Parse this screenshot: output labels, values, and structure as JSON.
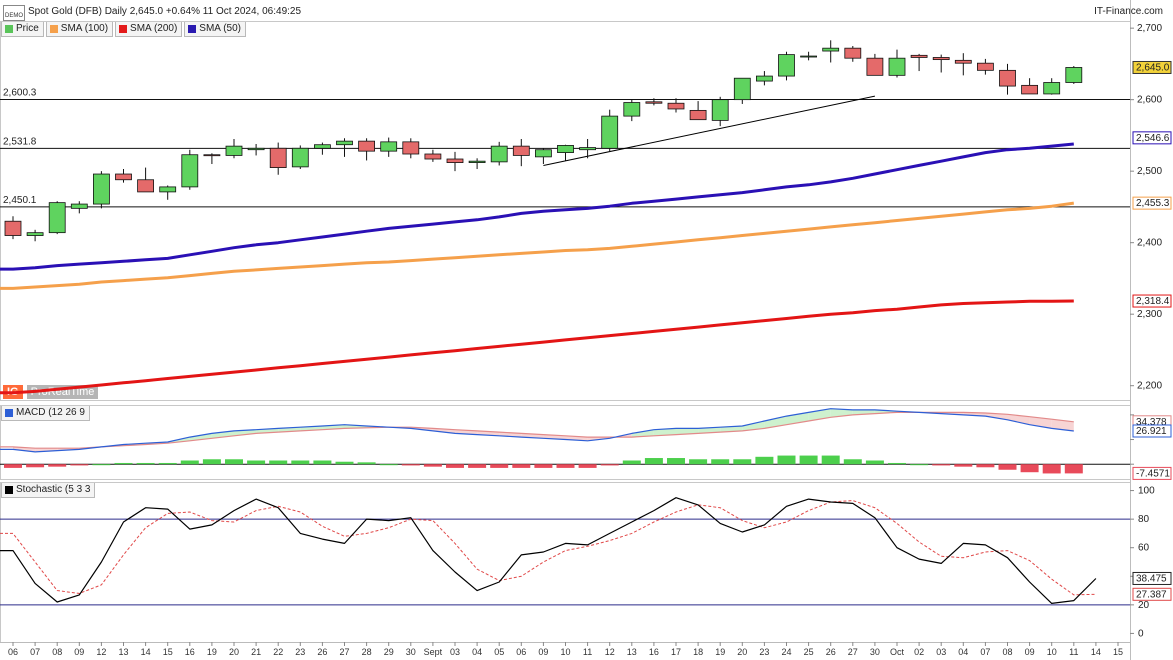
{
  "header": {
    "title": "Spot Gold (DFB) Daily 2,645.0 +0.64% 11 Oct 2024, 06:49:25",
    "brand": "IT-Finance.com",
    "badge": "DEMO",
    "logo_text": "IG",
    "logo_name": "ProRealTime"
  },
  "legend": [
    {
      "label": "Price",
      "color": "#59c459"
    },
    {
      "label": "SMA (100)",
      "color": "#f5a04b"
    },
    {
      "label": "SMA (200)",
      "color": "#e31a1a"
    },
    {
      "label": "SMA (50)",
      "color": "#2a1ab0"
    }
  ],
  "colors": {
    "up": "#5fd35f",
    "down": "#e46a6a",
    "sma50": "#2a10b5",
    "sma100": "#f5a04b",
    "sma200": "#e31515",
    "macd": "#2d5fd6",
    "signal": "#e28a8a",
    "stoch_k": "#000000",
    "stoch_d": "#e04848"
  },
  "chart_data": [
    {
      "type": "candlestick",
      "panel": "price",
      "categories": [
        "06",
        "07",
        "08",
        "09",
        "12",
        "13",
        "14",
        "15",
        "16",
        "19",
        "20",
        "21",
        "22",
        "23",
        "26",
        "27",
        "28",
        "29",
        "30",
        "Sept",
        "03",
        "04",
        "05",
        "06",
        "09",
        "10",
        "11",
        "12",
        "13",
        "16",
        "17",
        "18",
        "19",
        "20",
        "23",
        "24",
        "25",
        "26",
        "27",
        "30",
        "Oct",
        "02",
        "03",
        "04",
        "07",
        "08",
        "09",
        "10",
        "11"
      ],
      "x_ticks": [
        "06",
        "07",
        "08",
        "09",
        "12",
        "13",
        "14",
        "15",
        "16",
        "19",
        "20",
        "21",
        "22",
        "23",
        "26",
        "27",
        "28",
        "29",
        "30",
        "Sept",
        "03",
        "04",
        "05",
        "06",
        "09",
        "10",
        "11",
        "12",
        "13",
        "16",
        "17",
        "18",
        "19",
        "20",
        "23",
        "24",
        "25",
        "26",
        "27",
        "30",
        "Oct",
        "02",
        "03",
        "04",
        "07",
        "08",
        "09",
        "10",
        "11",
        "14",
        "15"
      ],
      "ohlc": [
        [
          2430,
          2437,
          2405,
          2410
        ],
        [
          2410,
          2418,
          2402,
          2414
        ],
        [
          2414,
          2458,
          2412,
          2456
        ],
        [
          2448,
          2458,
          2441,
          2454
        ],
        [
          2454,
          2500,
          2448,
          2496
        ],
        [
          2496,
          2503,
          2484,
          2488
        ],
        [
          2488,
          2505,
          2473,
          2471
        ],
        [
          2471,
          2480,
          2460,
          2478
        ],
        [
          2478,
          2530,
          2474,
          2523
        ],
        [
          2523,
          2525,
          2510,
          2522
        ],
        [
          2522,
          2545,
          2518,
          2535
        ],
        [
          2530,
          2538,
          2522,
          2532
        ],
        [
          2532,
          2540,
          2495,
          2505
        ],
        [
          2506,
          2536,
          2503,
          2532
        ],
        [
          2532,
          2540,
          2523,
          2537
        ],
        [
          2537,
          2546,
          2520,
          2542
        ],
        [
          2542,
          2546,
          2515,
          2528
        ],
        [
          2528,
          2547,
          2520,
          2541
        ],
        [
          2541,
          2546,
          2518,
          2524
        ],
        [
          2524,
          2530,
          2513,
          2517
        ],
        [
          2517,
          2527,
          2500,
          2512
        ],
        [
          2512,
          2518,
          2503,
          2514
        ],
        [
          2513,
          2541,
          2508,
          2535
        ],
        [
          2535,
          2545,
          2507,
          2522
        ],
        [
          2520,
          2532,
          2510,
          2530
        ],
        [
          2526,
          2537,
          2515,
          2536
        ],
        [
          2530,
          2545,
          2518,
          2533
        ],
        [
          2532,
          2586,
          2528,
          2577
        ],
        [
          2577,
          2600,
          2570,
          2596
        ],
        [
          2597,
          2602,
          2592,
          2595
        ],
        [
          2595,
          2602,
          2582,
          2587
        ],
        [
          2585,
          2598,
          2572,
          2572
        ],
        [
          2571,
          2604,
          2563,
          2600
        ],
        [
          2600,
          2628,
          2594,
          2630
        ],
        [
          2626,
          2640,
          2620,
          2633
        ],
        [
          2633,
          2667,
          2627,
          2663
        ],
        [
          2661,
          2667,
          2655,
          2661
        ],
        [
          2668,
          2683,
          2652,
          2672
        ],
        [
          2672,
          2675,
          2653,
          2658
        ],
        [
          2658,
          2664,
          2639,
          2634
        ],
        [
          2634,
          2670,
          2631,
          2658
        ],
        [
          2662,
          2664,
          2640,
          2659
        ],
        [
          2659,
          2663,
          2638,
          2656
        ],
        [
          2655,
          2665,
          2634,
          2651
        ],
        [
          2651,
          2657,
          2635,
          2641
        ],
        [
          2641,
          2650,
          2607,
          2619
        ],
        [
          2620,
          2630,
          2609,
          2608
        ],
        [
          2608,
          2630,
          2607,
          2624
        ],
        [
          2624,
          2647,
          2622,
          2645
        ]
      ],
      "sma50": [
        2363,
        2365,
        2368,
        2370,
        2372,
        2374,
        2376,
        2378,
        2383,
        2388,
        2393,
        2397,
        2400,
        2404,
        2408,
        2412,
        2416,
        2420,
        2423,
        2426,
        2429,
        2432,
        2436,
        2441,
        2444,
        2446,
        2448,
        2451,
        2455,
        2458,
        2461,
        2464,
        2467,
        2470,
        2474,
        2478,
        2481,
        2485,
        2490,
        2496,
        2502,
        2508,
        2514,
        2520,
        2526,
        2530,
        2532,
        2535,
        2538
      ],
      "sma100": [
        2336,
        2338,
        2340,
        2342,
        2345,
        2347,
        2349,
        2351,
        2354,
        2357,
        2360,
        2362,
        2364,
        2366,
        2368,
        2370,
        2372,
        2373,
        2375,
        2377,
        2379,
        2381,
        2383,
        2385,
        2387,
        2389,
        2390,
        2392,
        2395,
        2398,
        2401,
        2404,
        2407,
        2410,
        2413,
        2416,
        2419,
        2422,
        2425,
        2428,
        2431,
        2434,
        2437,
        2440,
        2443,
        2446,
        2448,
        2451,
        2455.3
      ],
      "sma200": [
        2190,
        2192,
        2195,
        2198,
        2201,
        2204,
        2207,
        2210,
        2213,
        2216,
        2219,
        2222,
        2225,
        2228,
        2231,
        2234,
        2237,
        2240,
        2243,
        2246,
        2249,
        2252,
        2255,
        2258,
        2261,
        2264,
        2267,
        2270,
        2273,
        2276,
        2279,
        2282,
        2285,
        2288,
        2291,
        2294,
        2297,
        2300,
        2302,
        2305,
        2307,
        2310,
        2313,
        2315,
        2316,
        2317,
        2318,
        2318.2,
        2318.4
      ],
      "trendline": {
        "from": {
          "index": 24,
          "value": 2508
        },
        "to": {
          "index": 39,
          "value": 2605
        }
      },
      "horizontal_lines": [
        {
          "value": 2600.3,
          "label": "2,600.3"
        },
        {
          "value": 2531.8,
          "label": "2,531.8"
        },
        {
          "value": 2450.1,
          "label": "2,450.1"
        }
      ],
      "y_ticks": [
        {
          "value": 2700,
          "label": "2,700"
        },
        {
          "value": 2600,
          "label": "2,600"
        },
        {
          "value": 2500,
          "label": "2,500"
        },
        {
          "value": 2400,
          "label": "2,400"
        },
        {
          "value": 2300,
          "label": "2,300"
        },
        {
          "value": 2200,
          "label": "2,200"
        }
      ],
      "y_range": [
        2180,
        2710
      ],
      "value_tags": [
        {
          "value": 2645.0,
          "label": "2,645.0",
          "style": "price"
        },
        {
          "value": 2546.6,
          "label": "2,546.6",
          "style": "sma50"
        },
        {
          "value": 2455.3,
          "label": "2,455.3",
          "style": "sma100"
        },
        {
          "value": 2318.4,
          "label": "2,318.4",
          "style": "sma200"
        }
      ]
    },
    {
      "type": "macd",
      "panel": "macd",
      "legend": "MACD (12 26 9",
      "macd": [
        12,
        10,
        11,
        12,
        14,
        16,
        17,
        18,
        22,
        25,
        27,
        28,
        29,
        30,
        31,
        32,
        31,
        30,
        29,
        27,
        25,
        24,
        23,
        22,
        21,
        20,
        19,
        21,
        25,
        28,
        29,
        29,
        30,
        31,
        35,
        39,
        42,
        45,
        44,
        44,
        43,
        42,
        41,
        40,
        39,
        36,
        32,
        29,
        26.921
      ],
      "signal": [
        14,
        13,
        13,
        13,
        14,
        15,
        16,
        17,
        19,
        21,
        23,
        25,
        26,
        27,
        28,
        29,
        29.5,
        30,
        30,
        29,
        28,
        27,
        26,
        25,
        24,
        23,
        22,
        22,
        22,
        23,
        24,
        25,
        26,
        27,
        29,
        32,
        35,
        38,
        40,
        41,
        42,
        42,
        42,
        42,
        41.5,
        40.5,
        38.5,
        36.5,
        34.378
      ],
      "histogram": [
        -3,
        -2.5,
        -2,
        -1,
        0,
        1,
        1,
        1,
        3,
        4,
        4,
        3,
        3,
        3,
        3,
        2,
        1.5,
        0,
        -1,
        -2,
        -3,
        -3,
        -3,
        -3,
        -3,
        -3,
        -3,
        -1,
        3,
        5,
        5,
        4,
        4,
        4,
        6,
        7,
        7,
        7,
        4,
        3,
        1,
        0,
        -1,
        -2,
        -2.5,
        -4.5,
        -6.5,
        -7.5,
        -7.4571
      ],
      "y_range": [
        -12,
        48
      ],
      "value_tags": [
        {
          "value": 34.378,
          "label": "34.378"
        },
        {
          "value": 26.921,
          "label": "26.921"
        },
        {
          "value": -7.4571,
          "label": "-7.4571"
        }
      ],
      "zero_line": 0
    },
    {
      "type": "stochastic",
      "panel": "stochastic",
      "legend": "Stochastic (5 3 3",
      "k": [
        58,
        35,
        22,
        27,
        50,
        78,
        88,
        87,
        73,
        76,
        86,
        94,
        88,
        70,
        66,
        63,
        80,
        79,
        81,
        58,
        43,
        30,
        36,
        55,
        57,
        63,
        62,
        70,
        78,
        86,
        95,
        90,
        77,
        71,
        76,
        89,
        94,
        92,
        91,
        81,
        60,
        52,
        49,
        63,
        62,
        53,
        36,
        21,
        23,
        38.475
      ],
      "d": [
        70,
        50,
        30,
        28,
        34,
        55,
        74,
        84,
        85,
        79,
        78,
        86,
        89,
        85,
        75,
        68,
        70,
        74,
        80,
        79,
        63,
        45,
        37,
        40,
        50,
        58,
        61,
        65,
        70,
        78,
        85,
        90,
        88,
        79,
        74,
        78,
        86,
        92,
        93,
        88,
        77,
        64,
        54,
        53,
        57,
        58,
        51,
        38,
        27,
        27.387
      ],
      "y_ticks": [
        100,
        80,
        60,
        40,
        20,
        0
      ],
      "y_range": [
        -6,
        106
      ],
      "reference_lines": [
        80,
        20
      ],
      "value_tags": [
        {
          "value": 38.475,
          "label": "38.475"
        },
        {
          "value": 27.387,
          "label": "27.387"
        }
      ]
    }
  ]
}
